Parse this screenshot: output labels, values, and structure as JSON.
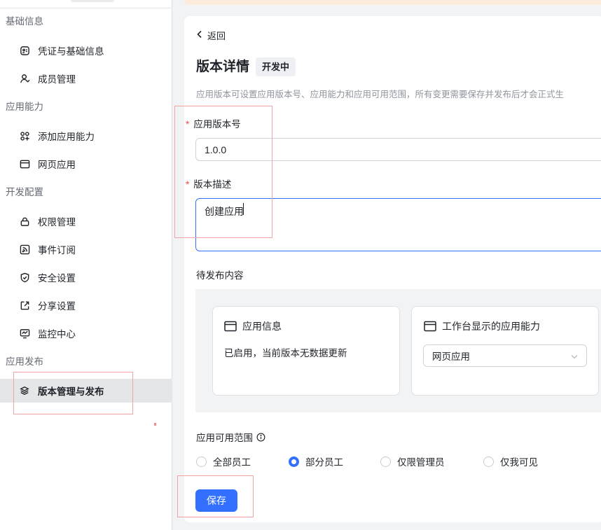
{
  "sidebar": {
    "groups": [
      {
        "title": "基础信息",
        "items": [
          {
            "label": "凭证与基础信息",
            "icon": "credential-icon"
          },
          {
            "label": "成员管理",
            "icon": "member-icon"
          }
        ]
      },
      {
        "title": "应用能力",
        "items": [
          {
            "label": "添加应用能力",
            "icon": "apps-add-icon"
          },
          {
            "label": "网页应用",
            "icon": "browser-icon"
          }
        ]
      },
      {
        "title": "开发配置",
        "items": [
          {
            "label": "权限管理",
            "icon": "lock-icon"
          },
          {
            "label": "事件订阅",
            "icon": "rss-icon"
          },
          {
            "label": "安全设置",
            "icon": "shield-icon"
          },
          {
            "label": "分享设置",
            "icon": "share-icon"
          },
          {
            "label": "监控中心",
            "icon": "monitor-icon"
          }
        ]
      },
      {
        "title": "应用发布",
        "items": [
          {
            "label": "版本管理与发布",
            "icon": "layers-icon",
            "active": true
          }
        ]
      }
    ]
  },
  "main": {
    "back_label": "返回",
    "title": "版本详情",
    "status": "开发中",
    "description": "应用版本可设置应用版本号、应用能力和应用可用范围，所有变更需要保存并发布后才会正式生",
    "version_field": {
      "label": "应用版本号",
      "value": "1.0.0"
    },
    "desc_field": {
      "label": "版本描述",
      "value": "创建应用"
    },
    "pending": {
      "title": "待发布内容",
      "app_info": {
        "title": "应用信息",
        "text": "已启用，当前版本无数据更新"
      },
      "workbench": {
        "title": "工作台显示的应用能力",
        "selected": "网页应用"
      }
    },
    "scope": {
      "title": "应用可用范围",
      "options": [
        "全部员工",
        "部分员工",
        "仅限管理员",
        "仅我可见"
      ],
      "selected": "部分员工"
    },
    "save_label": "保存"
  },
  "colors": {
    "primary": "#3370ff",
    "required": "#f54a45",
    "annotation": "#f2a3a3"
  }
}
